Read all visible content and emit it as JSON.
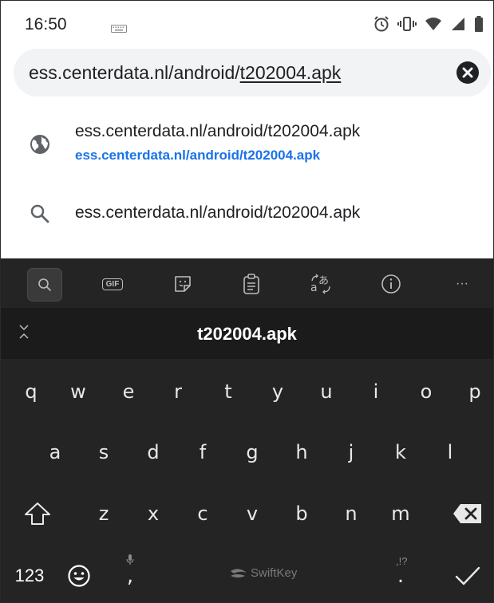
{
  "status_bar": {
    "time": "16:50",
    "icons": [
      "keyboard-icon",
      "alarm-icon",
      "vibrate-icon",
      "wifi-icon",
      "signal-icon",
      "battery-icon"
    ]
  },
  "url_bar": {
    "text_prefix": "ess.centerdata.nl/android/",
    "text_selected": "t202004.apk",
    "clear_icon": "close-icon"
  },
  "suggestions": [
    {
      "icon": "globe-icon",
      "title": "ess.centerdata.nl/android/t202004.apk",
      "subtitle": "ess.centerdata.nl/android/t202004.apk"
    },
    {
      "icon": "search-icon",
      "title": "ess.centerdata.nl/android/t202004.apk"
    }
  ],
  "keyboard": {
    "toolbar_icons": [
      "search-icon",
      "gif-icon",
      "sticker-icon",
      "clipboard-icon",
      "translate-icon",
      "info-icon",
      "more-icon"
    ],
    "gif_label": "GIF",
    "more_label": "···",
    "prediction": "t202004.apk",
    "row1": [
      "q",
      "w",
      "e",
      "r",
      "t",
      "y",
      "u",
      "i",
      "o",
      "p"
    ],
    "row2": [
      "a",
      "s",
      "d",
      "f",
      "g",
      "h",
      "j",
      "k",
      "l"
    ],
    "row3": [
      "z",
      "x",
      "c",
      "v",
      "b",
      "n",
      "m"
    ],
    "numbers_label": "123",
    "comma_label": ",",
    "period_label": ".",
    "punct_hint": ",!?",
    "brand": "SwiftKey",
    "colors": {
      "background": "#242424",
      "prediction_bar": "#1b1b1b",
      "key_text": "#e8e8e8",
      "link_blue": "#1a73e8"
    }
  }
}
